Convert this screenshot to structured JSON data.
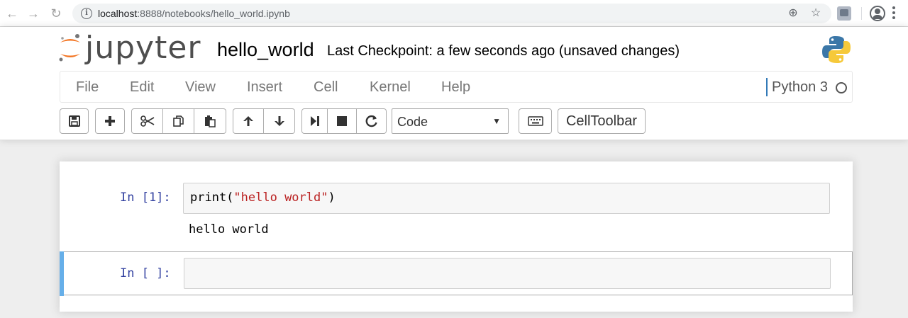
{
  "browser": {
    "url_host": "localhost",
    "url_path": ":8888/notebooks/hello_world.ipynb"
  },
  "header": {
    "logo_text": "jupyter",
    "notebook_name": "hello_world",
    "checkpoint": "Last Checkpoint: a few seconds ago (unsaved changes)"
  },
  "menu": {
    "items": [
      "File",
      "Edit",
      "View",
      "Insert",
      "Cell",
      "Kernel",
      "Help"
    ],
    "kernel_name": "Python 3"
  },
  "toolbar": {
    "cell_type": "Code",
    "celltoolbar_label": "CellToolbar"
  },
  "cells": [
    {
      "prompt": "In [1]:",
      "code_fn": "print(",
      "code_str": "\"hello world\"",
      "code_end": ")",
      "output": "hello world"
    },
    {
      "prompt": "In [ ]:",
      "code": ""
    }
  ],
  "colors": {
    "prompt": "#303f9f",
    "string": "#ba2121",
    "selected_cell_border": "#66afe9"
  }
}
